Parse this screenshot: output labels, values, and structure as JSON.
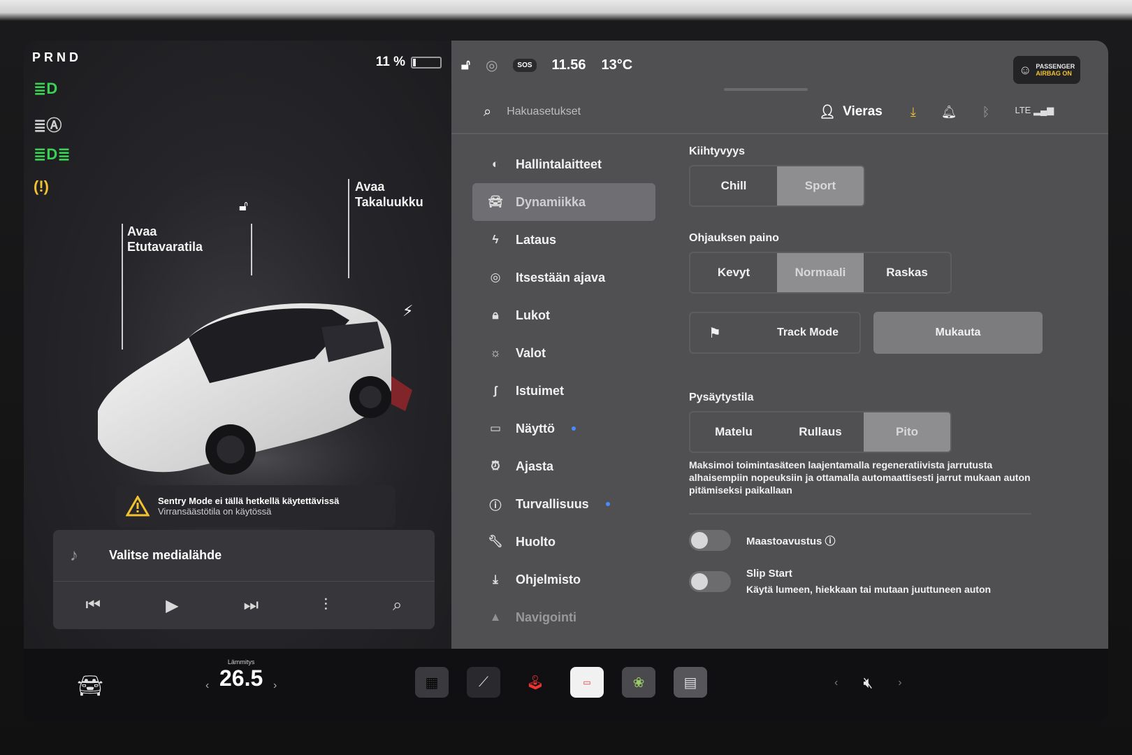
{
  "gear": "PRND",
  "battery": {
    "percent_label": "11 %",
    "level": 0.11
  },
  "car": {
    "front_trunk": "Avaa\nEtutavaratila",
    "rear_trunk": "Avaa\nTakaluukku"
  },
  "sentry": {
    "line1": "Sentry Mode ei tällä hetkellä käytettävissä",
    "line2": "Virransäästötila on käytössä"
  },
  "media": {
    "source_label": "Valitse medialähde"
  },
  "status": {
    "time": "11.56",
    "temperature": "13°C",
    "sos": "SOS",
    "airbag_line1": "PASSENGER",
    "airbag_line2": "AIRBAG ON"
  },
  "search": {
    "placeholder": "Hakuasetukset"
  },
  "user": {
    "name": "Vieras"
  },
  "menu": [
    {
      "label": "Hallintalaitteet",
      "icon": "toggle-icon"
    },
    {
      "label": "Dynamiikka",
      "icon": "car-icon"
    },
    {
      "label": "Lataus",
      "icon": "bolt-icon"
    },
    {
      "label": "Itsestään ajava",
      "icon": "steering-wheel-icon"
    },
    {
      "label": "Lukot",
      "icon": "lock-icon"
    },
    {
      "label": "Valot",
      "icon": "sun-icon"
    },
    {
      "label": "Istuimet",
      "icon": "seat-icon"
    },
    {
      "label": "Näyttö",
      "icon": "display-icon"
    },
    {
      "label": "Ajasta",
      "icon": "alarm-icon"
    },
    {
      "label": "Turvallisuus",
      "icon": "alert-circle-icon"
    },
    {
      "label": "Huolto",
      "icon": "wrench-icon"
    },
    {
      "label": "Ohjelmisto",
      "icon": "download-icon"
    },
    {
      "label": "Navigointi",
      "icon": "navigation-icon"
    }
  ],
  "acceleration": {
    "title": "Kiihtyvyys",
    "options": [
      "Chill",
      "Sport"
    ],
    "selected": "Sport"
  },
  "steering": {
    "title": "Ohjauksen paino",
    "options": [
      "Kevyt",
      "Normaali",
      "Raskas"
    ],
    "selected": "Normaali"
  },
  "track_mode": {
    "label": "Track Mode",
    "customize": "Mukauta"
  },
  "stopping": {
    "title": "Pysäytystila",
    "options": [
      "Matelu",
      "Rullaus",
      "Pito"
    ],
    "selected": "Pito",
    "description": "Maksimoi toimintasäteen laajentamalla regeneratiivista jarrutusta alhaisempiin nopeuksiin ja ottamalla automaattisesti jarrut mukaan auton pitämiseksi paikallaan"
  },
  "offroad": {
    "label": "Maastoavustus"
  },
  "slip_start": {
    "label": "Slip Start",
    "sub": "Käytä lumeen, hiekkaan tai mutaan juuttuneen auton"
  },
  "climate": {
    "label": "Lämmitys",
    "temp": "26.5"
  },
  "colors": {
    "accent_green": "#39d353",
    "warn_yellow": "#f2c230",
    "selected_tab": "#8e8e91"
  }
}
